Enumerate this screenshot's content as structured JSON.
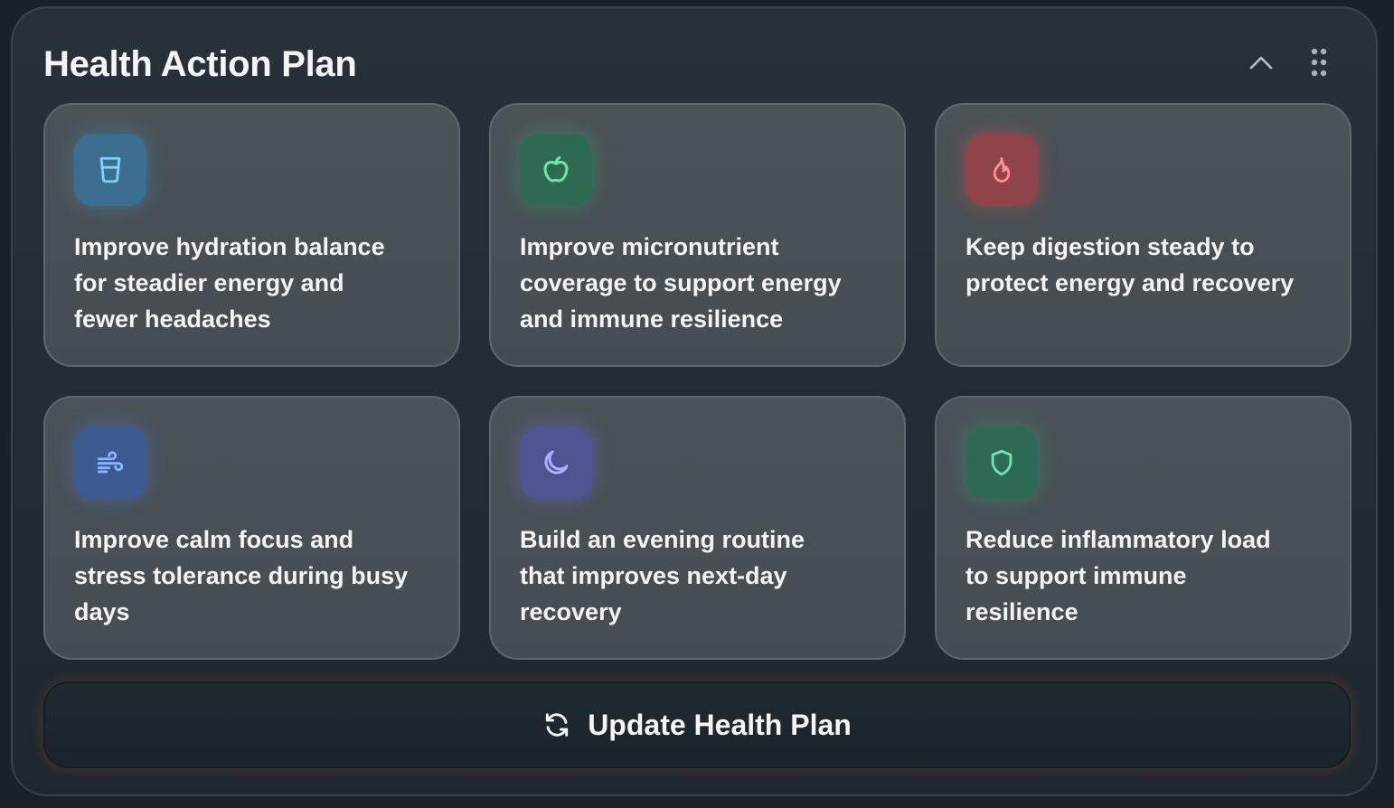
{
  "header": {
    "title": "Health Action Plan",
    "collapse_icon": "chevron-up-icon",
    "drag_icon": "drag-handle-icon"
  },
  "cards": [
    {
      "icon": "glass-icon",
      "icon_bg": "#3b6f8f",
      "icon_color": "#7fd1f5",
      "text": "Improve hydration balance for steadier energy and fewer headaches"
    },
    {
      "icon": "apple-icon",
      "icon_bg": "#2f6a52",
      "icon_color": "#6fe3a8",
      "text": "Improve micronutrient coverage to support energy and immune resilience"
    },
    {
      "icon": "flame-icon",
      "icon_bg": "#8e4448",
      "icon_color": "#ff8f95",
      "text": "Keep digestion steady to protect energy and recovery"
    },
    {
      "icon": "wind-icon",
      "icon_bg": "#3c5a92",
      "icon_color": "#8fb3ff",
      "text": "Improve calm focus and stress tolerance during busy days"
    },
    {
      "icon": "moon-icon",
      "icon_bg": "#4f538f",
      "icon_color": "#aab0ff",
      "text": "Build an evening routine that improves next-day recovery"
    },
    {
      "icon": "shield-icon",
      "icon_bg": "#2f6a56",
      "icon_color": "#6fe3b0",
      "text": "Reduce inflammatory load to support immune resilience"
    }
  ],
  "update_button": {
    "label": "Update Health Plan",
    "icon": "refresh-icon"
  }
}
